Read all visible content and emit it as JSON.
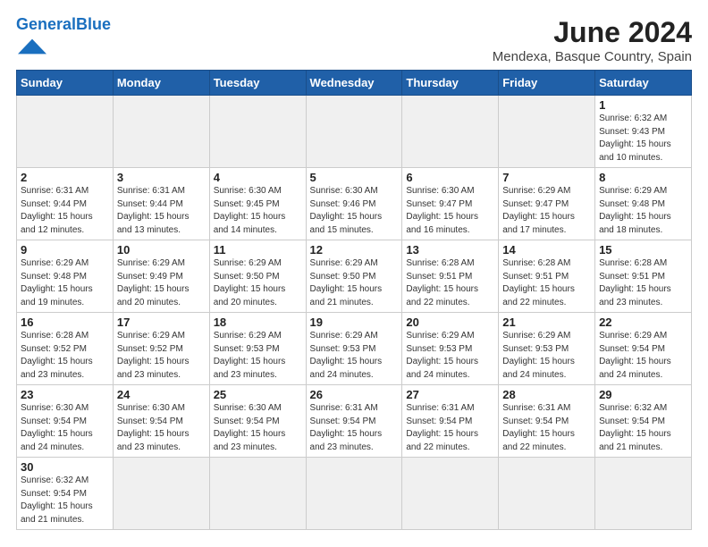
{
  "header": {
    "logo_text_general": "General",
    "logo_text_blue": "Blue",
    "main_title": "June 2024",
    "subtitle": "Mendexa, Basque Country, Spain"
  },
  "days_of_week": [
    "Sunday",
    "Monday",
    "Tuesday",
    "Wednesday",
    "Thursday",
    "Friday",
    "Saturday"
  ],
  "weeks": [
    [
      {
        "day": "",
        "empty": true
      },
      {
        "day": "",
        "empty": true
      },
      {
        "day": "",
        "empty": true
      },
      {
        "day": "",
        "empty": true
      },
      {
        "day": "",
        "empty": true
      },
      {
        "day": "",
        "empty": true
      },
      {
        "day": "1",
        "info": "Sunrise: 6:32 AM\nSunset: 9:43 PM\nDaylight: 15 hours\nand 10 minutes."
      }
    ],
    [
      {
        "day": "2",
        "info": "Sunrise: 6:31 AM\nSunset: 9:44 PM\nDaylight: 15 hours\nand 12 minutes."
      },
      {
        "day": "3",
        "info": "Sunrise: 6:31 AM\nSunset: 9:44 PM\nDaylight: 15 hours\nand 13 minutes."
      },
      {
        "day": "4",
        "info": "Sunrise: 6:30 AM\nSunset: 9:45 PM\nDaylight: 15 hours\nand 14 minutes."
      },
      {
        "day": "5",
        "info": "Sunrise: 6:30 AM\nSunset: 9:46 PM\nDaylight: 15 hours\nand 15 minutes."
      },
      {
        "day": "6",
        "info": "Sunrise: 6:30 AM\nSunset: 9:47 PM\nDaylight: 15 hours\nand 16 minutes."
      },
      {
        "day": "7",
        "info": "Sunrise: 6:29 AM\nSunset: 9:47 PM\nDaylight: 15 hours\nand 17 minutes."
      },
      {
        "day": "8",
        "info": "Sunrise: 6:29 AM\nSunset: 9:48 PM\nDaylight: 15 hours\nand 18 minutes."
      }
    ],
    [
      {
        "day": "9",
        "info": "Sunrise: 6:29 AM\nSunset: 9:48 PM\nDaylight: 15 hours\nand 19 minutes."
      },
      {
        "day": "10",
        "info": "Sunrise: 6:29 AM\nSunset: 9:49 PM\nDaylight: 15 hours\nand 20 minutes."
      },
      {
        "day": "11",
        "info": "Sunrise: 6:29 AM\nSunset: 9:50 PM\nDaylight: 15 hours\nand 20 minutes."
      },
      {
        "day": "12",
        "info": "Sunrise: 6:29 AM\nSunset: 9:50 PM\nDaylight: 15 hours\nand 21 minutes."
      },
      {
        "day": "13",
        "info": "Sunrise: 6:28 AM\nSunset: 9:51 PM\nDaylight: 15 hours\nand 22 minutes."
      },
      {
        "day": "14",
        "info": "Sunrise: 6:28 AM\nSunset: 9:51 PM\nDaylight: 15 hours\nand 22 minutes."
      },
      {
        "day": "15",
        "info": "Sunrise: 6:28 AM\nSunset: 9:51 PM\nDaylight: 15 hours\nand 23 minutes."
      }
    ],
    [
      {
        "day": "16",
        "info": "Sunrise: 6:28 AM\nSunset: 9:52 PM\nDaylight: 15 hours\nand 23 minutes."
      },
      {
        "day": "17",
        "info": "Sunrise: 6:29 AM\nSunset: 9:52 PM\nDaylight: 15 hours\nand 23 minutes."
      },
      {
        "day": "18",
        "info": "Sunrise: 6:29 AM\nSunset: 9:53 PM\nDaylight: 15 hours\nand 23 minutes."
      },
      {
        "day": "19",
        "info": "Sunrise: 6:29 AM\nSunset: 9:53 PM\nDaylight: 15 hours\nand 24 minutes."
      },
      {
        "day": "20",
        "info": "Sunrise: 6:29 AM\nSunset: 9:53 PM\nDaylight: 15 hours\nand 24 minutes."
      },
      {
        "day": "21",
        "info": "Sunrise: 6:29 AM\nSunset: 9:53 PM\nDaylight: 15 hours\nand 24 minutes."
      },
      {
        "day": "22",
        "info": "Sunrise: 6:29 AM\nSunset: 9:54 PM\nDaylight: 15 hours\nand 24 minutes."
      }
    ],
    [
      {
        "day": "23",
        "info": "Sunrise: 6:30 AM\nSunset: 9:54 PM\nDaylight: 15 hours\nand 24 minutes."
      },
      {
        "day": "24",
        "info": "Sunrise: 6:30 AM\nSunset: 9:54 PM\nDaylight: 15 hours\nand 23 minutes."
      },
      {
        "day": "25",
        "info": "Sunrise: 6:30 AM\nSunset: 9:54 PM\nDaylight: 15 hours\nand 23 minutes."
      },
      {
        "day": "26",
        "info": "Sunrise: 6:31 AM\nSunset: 9:54 PM\nDaylight: 15 hours\nand 23 minutes."
      },
      {
        "day": "27",
        "info": "Sunrise: 6:31 AM\nSunset: 9:54 PM\nDaylight: 15 hours\nand 22 minutes."
      },
      {
        "day": "28",
        "info": "Sunrise: 6:31 AM\nSunset: 9:54 PM\nDaylight: 15 hours\nand 22 minutes."
      },
      {
        "day": "29",
        "info": "Sunrise: 6:32 AM\nSunset: 9:54 PM\nDaylight: 15 hours\nand 21 minutes."
      }
    ],
    [
      {
        "day": "30",
        "info": "Sunrise: 6:32 AM\nSunset: 9:54 PM\nDaylight: 15 hours\nand 21 minutes."
      },
      {
        "day": "",
        "empty": true
      },
      {
        "day": "",
        "empty": true
      },
      {
        "day": "",
        "empty": true
      },
      {
        "day": "",
        "empty": true
      },
      {
        "day": "",
        "empty": true
      },
      {
        "day": "",
        "empty": true
      }
    ]
  ]
}
